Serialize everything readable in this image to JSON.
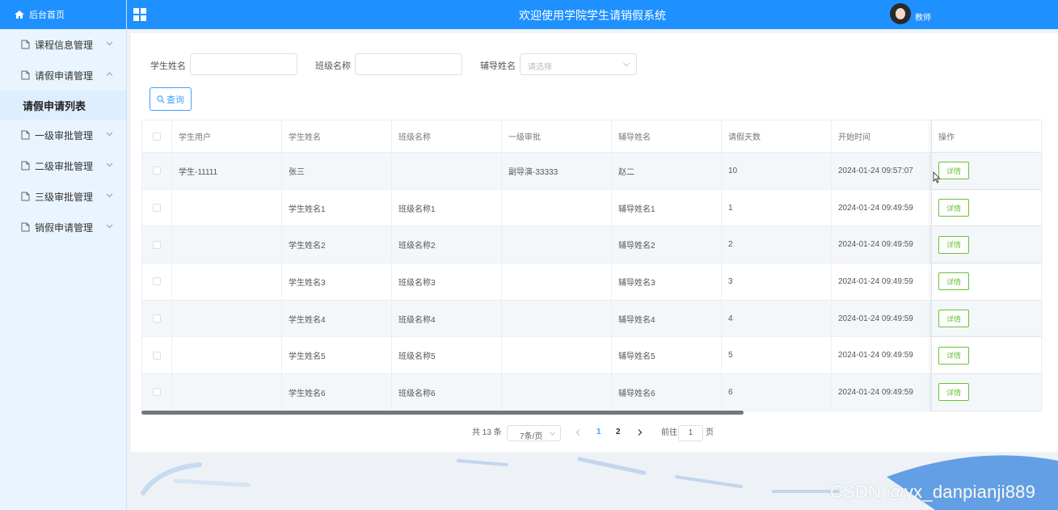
{
  "sidebar": {
    "home_label": "后台首页",
    "items": [
      {
        "label": "课程信息管理",
        "expanded": false
      },
      {
        "label": "请假申请管理",
        "expanded": true
      },
      {
        "label": "一级审批管理",
        "expanded": false
      },
      {
        "label": "二级审批管理",
        "expanded": false
      },
      {
        "label": "三级审批管理",
        "expanded": false
      },
      {
        "label": "销假申请管理",
        "expanded": false
      }
    ],
    "sub_item": "请假申请列表"
  },
  "header": {
    "title": "欢迎使用学院学生请销假系统",
    "role": "教师",
    "bg_color": "#1e90ff"
  },
  "search": {
    "student_name_label": "学生姓名",
    "class_name_label": "班级名称",
    "counselor_label": "辅导姓名",
    "counselor_placeholder": "请选择",
    "query_button": "查询"
  },
  "table": {
    "columns": [
      "学生用户",
      "学生姓名",
      "班级名称",
      "一级审批",
      "辅导姓名",
      "请假天数",
      "开始时间",
      "操作"
    ],
    "detail_label": "详情",
    "rows": [
      [
        "学生-11111",
        "张三",
        "",
        "副导演-33333",
        "赵二",
        "10",
        "2024-01-24 09:57:07"
      ],
      [
        "",
        "学生姓名1",
        "班级名称1",
        "",
        "辅导姓名1",
        "1",
        "2024-01-24 09:49:59"
      ],
      [
        "",
        "学生姓名2",
        "班级名称2",
        "",
        "辅导姓名2",
        "2",
        "2024-01-24 09:49:59"
      ],
      [
        "",
        "学生姓名3",
        "班级名称3",
        "",
        "辅导姓名3",
        "3",
        "2024-01-24 09:49:59"
      ],
      [
        "",
        "学生姓名4",
        "班级名称4",
        "",
        "辅导姓名4",
        "4",
        "2024-01-24 09:49:59"
      ],
      [
        "",
        "学生姓名5",
        "班级名称5",
        "",
        "辅导姓名5",
        "5",
        "2024-01-24 09:49:59"
      ],
      [
        "",
        "学生姓名6",
        "班级名称6",
        "",
        "辅导姓名6",
        "6",
        "2024-01-24 09:49:59"
      ]
    ]
  },
  "pagination": {
    "total_text": "共 13 条",
    "page_size": "7条/页",
    "pages": [
      "1",
      "2"
    ],
    "current_page": "1",
    "goto_label": "前往",
    "goto_value": "1",
    "page_suffix": "页"
  },
  "watermark": "CSDN @vx_danpianji889"
}
